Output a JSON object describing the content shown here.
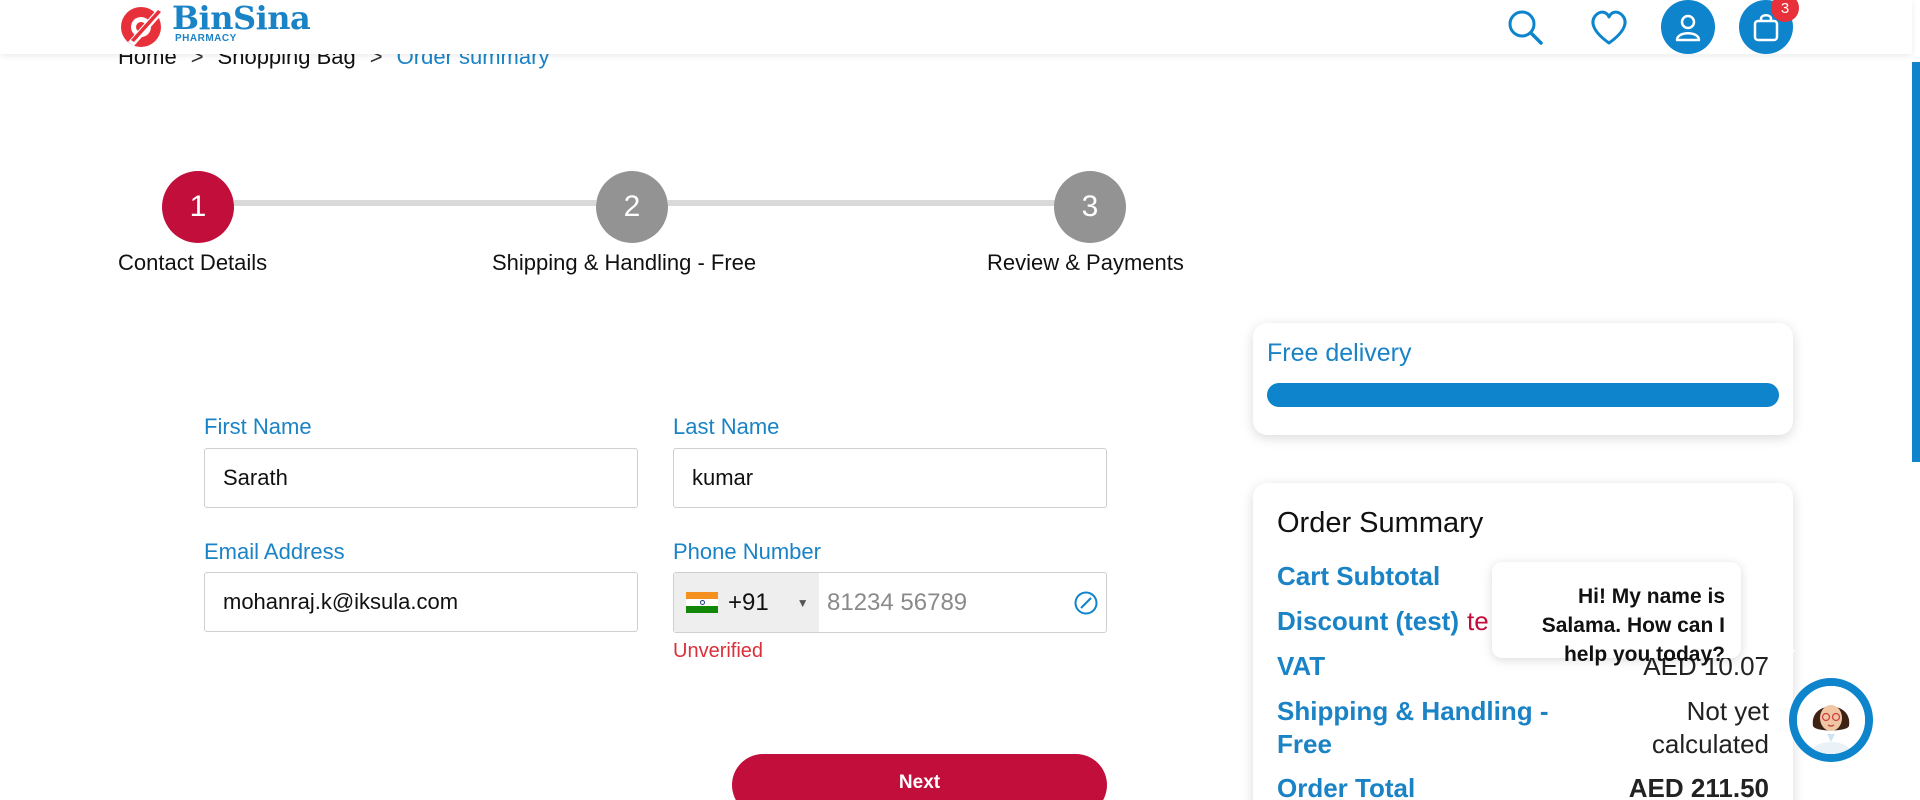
{
  "header": {
    "logo_name": "BinSina",
    "logo_sub": "PHARMACY",
    "cart_count": "3"
  },
  "breadcrumb": {
    "items": [
      "Home",
      "Shopping Bag",
      "Order summary"
    ],
    "separator": ">"
  },
  "stepper": {
    "steps": [
      {
        "number": "1",
        "label": "Contact Details",
        "state": "active"
      },
      {
        "number": "2",
        "label": "Shipping & Handling - Free",
        "state": "inactive"
      },
      {
        "number": "3",
        "label": "Review & Payments",
        "state": "inactive"
      }
    ]
  },
  "form": {
    "first_name_label": "First Name",
    "first_name_value": "Sarath",
    "last_name_label": "Last Name",
    "last_name_value": "kumar",
    "email_label": "Email Address",
    "email_value": "mohanraj.k@iksula.com",
    "phone_label": "Phone Number",
    "country_code": "+91",
    "phone_placeholder": "81234 56789",
    "phone_status": "Unverified",
    "next_label": "Next"
  },
  "free_delivery": {
    "title": "Free delivery",
    "progress": 1.0
  },
  "order_summary": {
    "title": "Order Summary",
    "rows": [
      {
        "label": "Cart Subtotal",
        "value": ""
      },
      {
        "label": "Discount (test)",
        "value": "te"
      },
      {
        "label": "VAT",
        "value": "AED 10.07"
      },
      {
        "label": "Shipping & Handling - Free",
        "value": "Not yet calculated"
      },
      {
        "label": "Order Total",
        "value": "AED 211.50"
      }
    ]
  },
  "chat": {
    "message": "Hi! My name is Salama. How can I help you today?"
  },
  "colors": {
    "brand_blue": "#0d84cb",
    "brand_red": "#c10e3b",
    "inactive_step": "#939393",
    "error_red": "#d9303a"
  }
}
